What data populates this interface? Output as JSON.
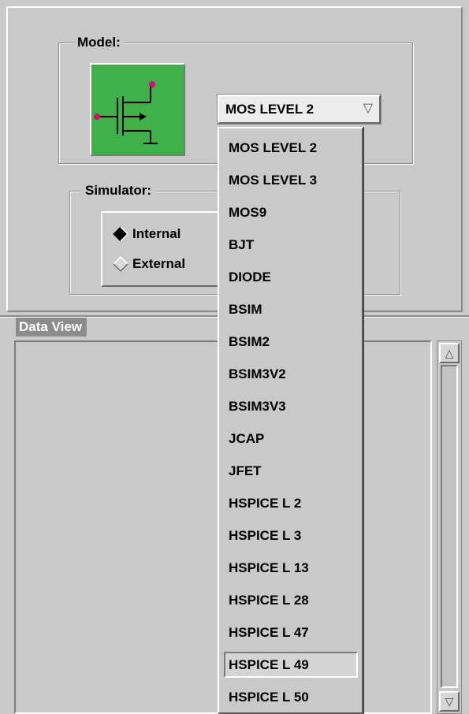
{
  "model": {
    "legend": "Model:",
    "icon": "mosfet-transistor-icon",
    "icon_color": "#40b04a",
    "combo_value": "MOS LEVEL 2",
    "combo_arrow": "chevron-down-icon"
  },
  "simulator": {
    "legend": "Simulator:",
    "options": [
      {
        "label": "Internal",
        "selected": true
      },
      {
        "label": "External",
        "selected": false
      }
    ]
  },
  "data_view": {
    "legend": "Data View"
  },
  "dropdown": {
    "items": [
      "MOS LEVEL 2",
      "MOS LEVEL 3",
      "MOS9",
      "BJT",
      "DIODE",
      "BSIM",
      "BSIM2",
      "BSIM3V2",
      "BSIM3V3",
      "JCAP",
      "JFET",
      "HSPICE L 2",
      "HSPICE L 3",
      "HSPICE L 13",
      "HSPICE L 28",
      "HSPICE L 47",
      "HSPICE L 49",
      "HSPICE L 50"
    ],
    "highlighted": "HSPICE L 49"
  }
}
